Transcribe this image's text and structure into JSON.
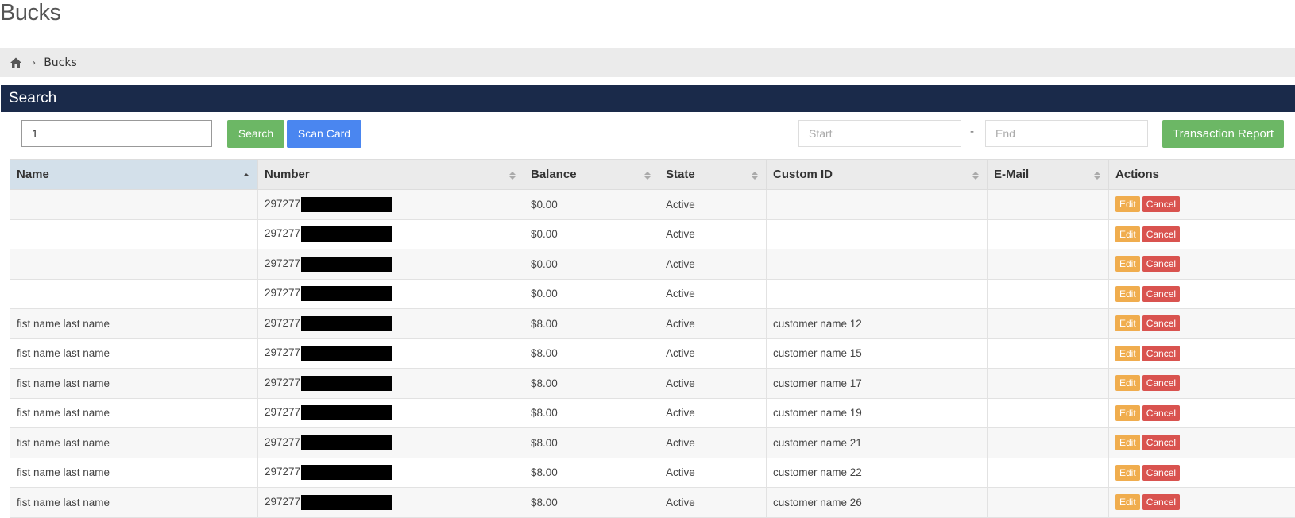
{
  "page": {
    "title": "Bucks"
  },
  "breadcrumb": {
    "home_icon": "home-icon",
    "current": "Bucks"
  },
  "panel": {
    "title": "Search"
  },
  "search": {
    "value": "1",
    "search_label": "Search",
    "scan_label": "Scan Card"
  },
  "report": {
    "start_placeholder": "Start",
    "end_placeholder": "End",
    "separator": "-",
    "button_label": "Transaction Report"
  },
  "colors": {
    "header_bg": "#1a2a4a",
    "green": "#6cb765",
    "blue": "#4a86f0",
    "edit": "#f0ad4e",
    "cancel": "#d9534f"
  },
  "table": {
    "columns": [
      "Name",
      "Number",
      "Balance",
      "State",
      "Custom ID",
      "E-Mail",
      "Actions"
    ],
    "sorted_column": "Name",
    "rows": [
      {
        "name": "",
        "number": "297277",
        "balance": "$0.00",
        "state": "Active",
        "custom_id": "",
        "email": ""
      },
      {
        "name": "",
        "number": "297277",
        "balance": "$0.00",
        "state": "Active",
        "custom_id": "",
        "email": ""
      },
      {
        "name": "",
        "number": "297277",
        "balance": "$0.00",
        "state": "Active",
        "custom_id": "",
        "email": ""
      },
      {
        "name": "",
        "number": "297277",
        "balance": "$0.00",
        "state": "Active",
        "custom_id": "",
        "email": ""
      },
      {
        "name": "fist name last name",
        "number": "297277",
        "balance": "$8.00",
        "state": "Active",
        "custom_id": "customer name 12",
        "email": ""
      },
      {
        "name": "fist name last name",
        "number": "297277",
        "balance": "$8.00",
        "state": "Active",
        "custom_id": "customer name 15",
        "email": ""
      },
      {
        "name": "fist name last name",
        "number": "297277",
        "balance": "$8.00",
        "state": "Active",
        "custom_id": "customer name 17",
        "email": ""
      },
      {
        "name": "fist name last name",
        "number": "297277",
        "balance": "$8.00",
        "state": "Active",
        "custom_id": "customer name 19",
        "email": ""
      },
      {
        "name": "fist name last name",
        "number": "297277",
        "balance": "$8.00",
        "state": "Active",
        "custom_id": "customer name 21",
        "email": ""
      },
      {
        "name": "fist name last name",
        "number": "297277",
        "balance": "$8.00",
        "state": "Active",
        "custom_id": "customer name 22",
        "email": ""
      },
      {
        "name": "fist name last name",
        "number": "297277",
        "balance": "$8.00",
        "state": "Active",
        "custom_id": "customer name 26",
        "email": ""
      }
    ],
    "actions": {
      "edit_label": "Edit",
      "cancel_label": "Cancel"
    }
  }
}
